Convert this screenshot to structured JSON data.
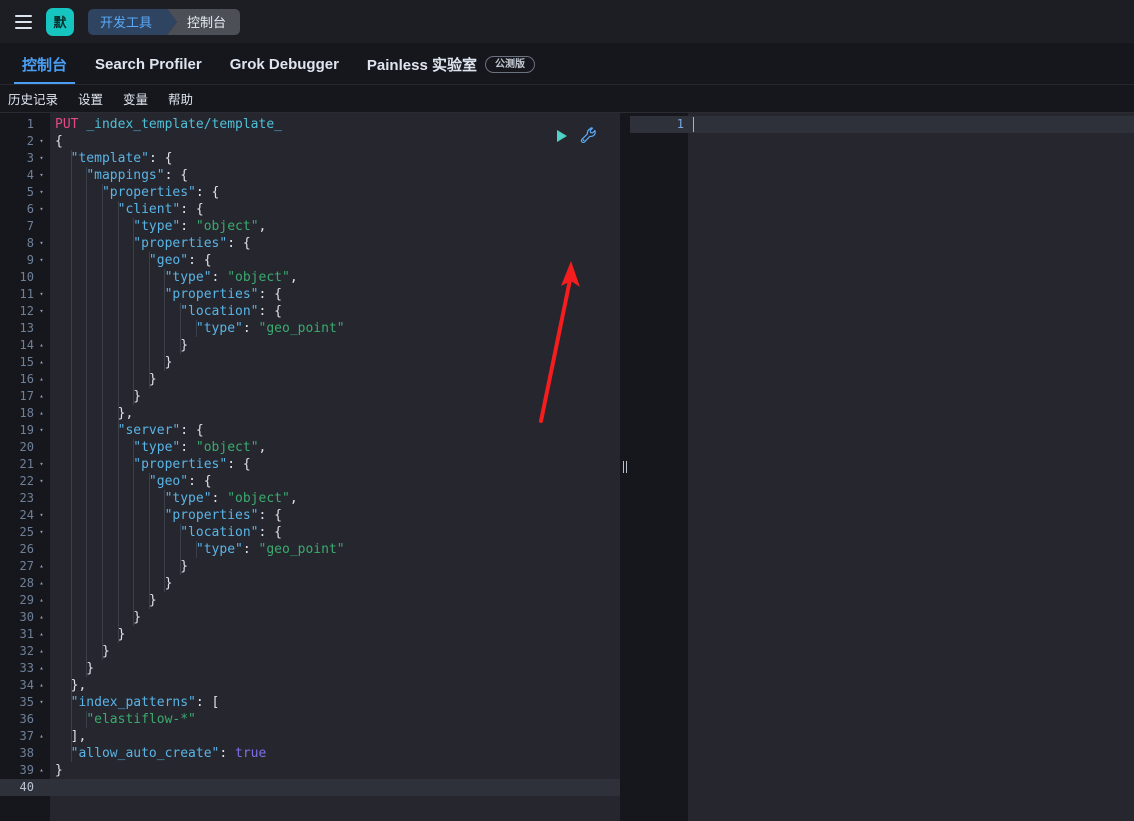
{
  "chrome": {
    "menu_icon": "hamburger-icon",
    "space_badge": "默",
    "breadcrumb": [
      {
        "label": "开发工具",
        "active": true
      },
      {
        "label": "控制台",
        "active": false
      }
    ]
  },
  "tabs": [
    {
      "label": "控制台",
      "active": true,
      "badge": null
    },
    {
      "label": "Search Profiler",
      "active": false,
      "badge": null
    },
    {
      "label": "Grok Debugger",
      "active": false,
      "badge": null
    },
    {
      "label": "Painless 实验室",
      "active": false,
      "badge": "公测版"
    }
  ],
  "submenu": [
    {
      "label": "历史记录"
    },
    {
      "label": "设置"
    },
    {
      "label": "变量"
    },
    {
      "label": "帮助"
    }
  ],
  "editor": {
    "play_icon": "play-triangle-icon",
    "wrench_icon": "wrench-icon",
    "splitter_icon": "drag-grip-icon",
    "current_line": 40,
    "total_lines": 40,
    "lines": [
      {
        "n": 1,
        "fold": "",
        "tokens": [
          {
            "t": "PUT ",
            "c": "k-method"
          },
          {
            "t": "_index_template/template_",
            "c": "k-url"
          }
        ]
      },
      {
        "n": 2,
        "fold": "▾",
        "tokens": [
          {
            "t": "{",
            "c": "k-punc"
          }
        ]
      },
      {
        "n": 3,
        "fold": "▾",
        "tokens": [
          {
            "t": "  ",
            "c": ""
          },
          {
            "t": "\"template\"",
            "c": "k-key"
          },
          {
            "t": ": {",
            "c": "k-punc"
          }
        ]
      },
      {
        "n": 4,
        "fold": "▾",
        "tokens": [
          {
            "t": "    ",
            "c": ""
          },
          {
            "t": "\"mappings\"",
            "c": "k-key"
          },
          {
            "t": ": {",
            "c": "k-punc"
          }
        ]
      },
      {
        "n": 5,
        "fold": "▾",
        "tokens": [
          {
            "t": "      ",
            "c": ""
          },
          {
            "t": "\"properties\"",
            "c": "k-key"
          },
          {
            "t": ": {",
            "c": "k-punc"
          }
        ]
      },
      {
        "n": 6,
        "fold": "▾",
        "tokens": [
          {
            "t": "        ",
            "c": ""
          },
          {
            "t": "\"client\"",
            "c": "k-key"
          },
          {
            "t": ": {",
            "c": "k-punc"
          }
        ]
      },
      {
        "n": 7,
        "fold": "",
        "tokens": [
          {
            "t": "          ",
            "c": ""
          },
          {
            "t": "\"type\"",
            "c": "k-key"
          },
          {
            "t": ": ",
            "c": "k-punc"
          },
          {
            "t": "\"object\"",
            "c": "k-str"
          },
          {
            "t": ",",
            "c": "k-punc"
          }
        ]
      },
      {
        "n": 8,
        "fold": "▾",
        "tokens": [
          {
            "t": "          ",
            "c": ""
          },
          {
            "t": "\"properties\"",
            "c": "k-key"
          },
          {
            "t": ": {",
            "c": "k-punc"
          }
        ]
      },
      {
        "n": 9,
        "fold": "▾",
        "tokens": [
          {
            "t": "            ",
            "c": ""
          },
          {
            "t": "\"geo\"",
            "c": "k-key"
          },
          {
            "t": ": {",
            "c": "k-punc"
          }
        ]
      },
      {
        "n": 10,
        "fold": "",
        "tokens": [
          {
            "t": "              ",
            "c": ""
          },
          {
            "t": "\"type\"",
            "c": "k-key"
          },
          {
            "t": ": ",
            "c": "k-punc"
          },
          {
            "t": "\"object\"",
            "c": "k-str"
          },
          {
            "t": ",",
            "c": "k-punc"
          }
        ]
      },
      {
        "n": 11,
        "fold": "▾",
        "tokens": [
          {
            "t": "              ",
            "c": ""
          },
          {
            "t": "\"properties\"",
            "c": "k-key"
          },
          {
            "t": ": {",
            "c": "k-punc"
          }
        ]
      },
      {
        "n": 12,
        "fold": "▾",
        "tokens": [
          {
            "t": "                ",
            "c": ""
          },
          {
            "t": "\"location\"",
            "c": "k-key"
          },
          {
            "t": ": {",
            "c": "k-punc"
          }
        ]
      },
      {
        "n": 13,
        "fold": "",
        "tokens": [
          {
            "t": "                  ",
            "c": ""
          },
          {
            "t": "\"type\"",
            "c": "k-key"
          },
          {
            "t": ": ",
            "c": "k-punc"
          },
          {
            "t": "\"geo_point\"",
            "c": "k-str"
          }
        ]
      },
      {
        "n": 14,
        "fold": "▴",
        "tokens": [
          {
            "t": "                }",
            "c": "k-punc"
          }
        ]
      },
      {
        "n": 15,
        "fold": "▴",
        "tokens": [
          {
            "t": "              }",
            "c": "k-punc"
          }
        ]
      },
      {
        "n": 16,
        "fold": "▴",
        "tokens": [
          {
            "t": "            }",
            "c": "k-punc"
          }
        ]
      },
      {
        "n": 17,
        "fold": "▴",
        "tokens": [
          {
            "t": "          }",
            "c": "k-punc"
          }
        ]
      },
      {
        "n": 18,
        "fold": "▴",
        "tokens": [
          {
            "t": "        },",
            "c": "k-punc"
          }
        ]
      },
      {
        "n": 19,
        "fold": "▾",
        "tokens": [
          {
            "t": "        ",
            "c": ""
          },
          {
            "t": "\"server\"",
            "c": "k-key"
          },
          {
            "t": ": {",
            "c": "k-punc"
          }
        ]
      },
      {
        "n": 20,
        "fold": "",
        "tokens": [
          {
            "t": "          ",
            "c": ""
          },
          {
            "t": "\"type\"",
            "c": "k-key"
          },
          {
            "t": ": ",
            "c": "k-punc"
          },
          {
            "t": "\"object\"",
            "c": "k-str"
          },
          {
            "t": ",",
            "c": "k-punc"
          }
        ]
      },
      {
        "n": 21,
        "fold": "▾",
        "tokens": [
          {
            "t": "          ",
            "c": ""
          },
          {
            "t": "\"properties\"",
            "c": "k-key"
          },
          {
            "t": ": {",
            "c": "k-punc"
          }
        ]
      },
      {
        "n": 22,
        "fold": "▾",
        "tokens": [
          {
            "t": "            ",
            "c": ""
          },
          {
            "t": "\"geo\"",
            "c": "k-key"
          },
          {
            "t": ": {",
            "c": "k-punc"
          }
        ]
      },
      {
        "n": 23,
        "fold": "",
        "tokens": [
          {
            "t": "              ",
            "c": ""
          },
          {
            "t": "\"type\"",
            "c": "k-key"
          },
          {
            "t": ": ",
            "c": "k-punc"
          },
          {
            "t": "\"object\"",
            "c": "k-str"
          },
          {
            "t": ",",
            "c": "k-punc"
          }
        ]
      },
      {
        "n": 24,
        "fold": "▾",
        "tokens": [
          {
            "t": "              ",
            "c": ""
          },
          {
            "t": "\"properties\"",
            "c": "k-key"
          },
          {
            "t": ": {",
            "c": "k-punc"
          }
        ]
      },
      {
        "n": 25,
        "fold": "▾",
        "tokens": [
          {
            "t": "                ",
            "c": ""
          },
          {
            "t": "\"location\"",
            "c": "k-key"
          },
          {
            "t": ": {",
            "c": "k-punc"
          }
        ]
      },
      {
        "n": 26,
        "fold": "",
        "tokens": [
          {
            "t": "                  ",
            "c": ""
          },
          {
            "t": "\"type\"",
            "c": "k-key"
          },
          {
            "t": ": ",
            "c": "k-punc"
          },
          {
            "t": "\"geo_point\"",
            "c": "k-str"
          }
        ]
      },
      {
        "n": 27,
        "fold": "▴",
        "tokens": [
          {
            "t": "                }",
            "c": "k-punc"
          }
        ]
      },
      {
        "n": 28,
        "fold": "▴",
        "tokens": [
          {
            "t": "              }",
            "c": "k-punc"
          }
        ]
      },
      {
        "n": 29,
        "fold": "▴",
        "tokens": [
          {
            "t": "            }",
            "c": "k-punc"
          }
        ]
      },
      {
        "n": 30,
        "fold": "▴",
        "tokens": [
          {
            "t": "          }",
            "c": "k-punc"
          }
        ]
      },
      {
        "n": 31,
        "fold": "▴",
        "tokens": [
          {
            "t": "        }",
            "c": "k-punc"
          }
        ]
      },
      {
        "n": 32,
        "fold": "▴",
        "tokens": [
          {
            "t": "      }",
            "c": "k-punc"
          }
        ]
      },
      {
        "n": 33,
        "fold": "▴",
        "tokens": [
          {
            "t": "    }",
            "c": "k-punc"
          }
        ]
      },
      {
        "n": 34,
        "fold": "▴",
        "tokens": [
          {
            "t": "  },",
            "c": "k-punc"
          }
        ]
      },
      {
        "n": 35,
        "fold": "▾",
        "tokens": [
          {
            "t": "  ",
            "c": ""
          },
          {
            "t": "\"index_patterns\"",
            "c": "k-key"
          },
          {
            "t": ": [",
            "c": "k-punc"
          }
        ]
      },
      {
        "n": 36,
        "fold": "",
        "tokens": [
          {
            "t": "    ",
            "c": ""
          },
          {
            "t": "\"elastiflow-*\"",
            "c": "k-str"
          }
        ]
      },
      {
        "n": 37,
        "fold": "▴",
        "tokens": [
          {
            "t": "  ],",
            "c": "k-punc"
          }
        ]
      },
      {
        "n": 38,
        "fold": "",
        "tokens": [
          {
            "t": "  ",
            "c": ""
          },
          {
            "t": "\"allow_auto_create\"",
            "c": "k-key"
          },
          {
            "t": ": ",
            "c": "k-punc"
          },
          {
            "t": "true",
            "c": "k-bool"
          }
        ]
      },
      {
        "n": 39,
        "fold": "▴",
        "tokens": [
          {
            "t": "}",
            "c": "k-punc"
          }
        ]
      },
      {
        "n": 40,
        "fold": "",
        "tokens": [
          {
            "t": "",
            "c": ""
          }
        ]
      }
    ]
  },
  "response_panel": {
    "lines": [
      {
        "n": 1,
        "content": ""
      }
    ]
  },
  "annotation": {
    "arrow_color": "#f51d1d",
    "points_to": "play-button"
  },
  "colors": {
    "accent_blue": "#4a9ff5",
    "space_teal": "#16c5c0",
    "play_teal": "#4fd1c5",
    "wrench_blue": "#5aa9f8",
    "editor_bg": "#25262e",
    "gutter_bg": "#16171c",
    "chrome_bg": "#1d1e24"
  }
}
